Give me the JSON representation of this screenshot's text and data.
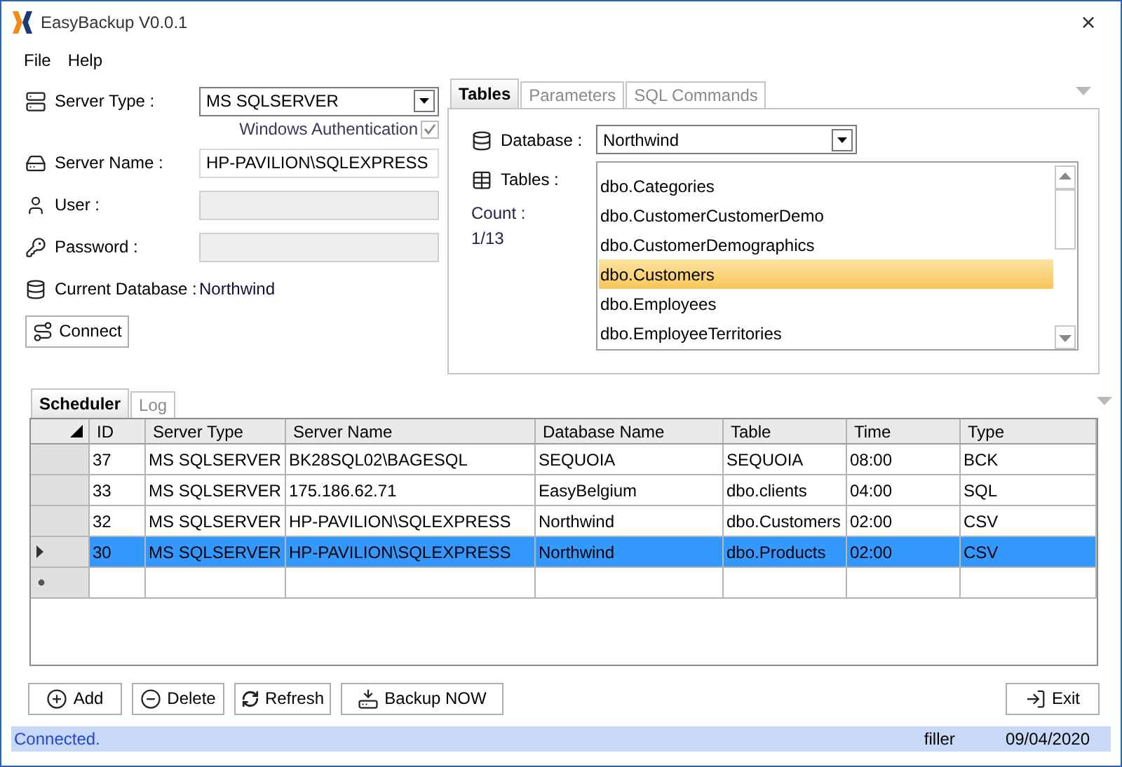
{
  "window": {
    "title": "EasyBackup V0.0.1",
    "close": "×"
  },
  "menu": [
    "File",
    "Help"
  ],
  "server_form": {
    "server_type": {
      "label": "Server Type :",
      "value": "MS SQLSERVER"
    },
    "windows_auth": {
      "label": "Windows Authentication",
      "checked": true,
      "disabled": true
    },
    "server_name": {
      "label": "Server Name :",
      "value": "HP-PAVILION\\SQLEXPRESS"
    },
    "user": {
      "label": "User :",
      "disabled": true
    },
    "password": {
      "label": "Password :",
      "disabled": true
    },
    "current_database": {
      "label": "Current Database :",
      "value": "Northwind"
    },
    "connect_button": "Connect"
  },
  "top_tabs": [
    {
      "label": "Tables",
      "selected": true
    },
    {
      "label": "Parameters",
      "selected": false
    },
    {
      "label": "SQL Commands",
      "selected": false
    }
  ],
  "tables_tab": {
    "database": {
      "label": "Database :",
      "value": "Northwind"
    },
    "tables_label": "Tables :",
    "count_label": "Count :",
    "count": "1/13",
    "tables": [
      {
        "name": "dbo.Categories",
        "selected": false
      },
      {
        "name": "dbo.CustomerCustomerDemo",
        "selected": false
      },
      {
        "name": "dbo.CustomerDemographics",
        "selected": false
      },
      {
        "name": "dbo.Customers",
        "selected": true
      },
      {
        "name": "dbo.Employees",
        "selected": false
      },
      {
        "name": "dbo.EmployeeTerritories",
        "selected": false
      }
    ]
  },
  "bottom_tabs": [
    {
      "label": "Scheduler",
      "selected": true
    },
    {
      "label": "Log",
      "selected": false
    }
  ],
  "grid": {
    "columns": [
      "ID",
      "Server Type",
      "Server Name",
      "Database Name",
      "Table",
      "Time",
      "Type"
    ],
    "rows": [
      {
        "cells": [
          "37",
          "MS SQLSERVER",
          "BK28SQL02\\BAGESQL",
          "SEQUOIA",
          "SEQUOIA",
          "08:00",
          "BCK"
        ],
        "selected": false
      },
      {
        "cells": [
          "33",
          "MS SQLSERVER",
          "175.186.62.71",
          "EasyBelgium",
          "dbo.clients",
          "04:00",
          "SQL"
        ],
        "selected": false
      },
      {
        "cells": [
          "32",
          "MS SQLSERVER",
          "HP-PAVILION\\SQLEXPRESS",
          "Northwind",
          "dbo.Customers",
          "02:00",
          "CSV"
        ],
        "selected": false
      },
      {
        "cells": [
          "30",
          "MS SQLSERVER",
          "HP-PAVILION\\SQLEXPRESS",
          "Northwind",
          "dbo.Products",
          "02:00",
          "CSV"
        ],
        "selected": true
      }
    ]
  },
  "buttons": [
    {
      "label": "Add",
      "kind": "add"
    },
    {
      "label": "Delete",
      "kind": "delete"
    },
    {
      "label": "Refresh",
      "kind": "refresh"
    },
    {
      "label": "Backup NOW",
      "kind": "backup"
    }
  ],
  "exit_button": "Exit",
  "status_bar": {
    "message": "Connected.",
    "filler": "filler",
    "date": "09/04/2020"
  }
}
